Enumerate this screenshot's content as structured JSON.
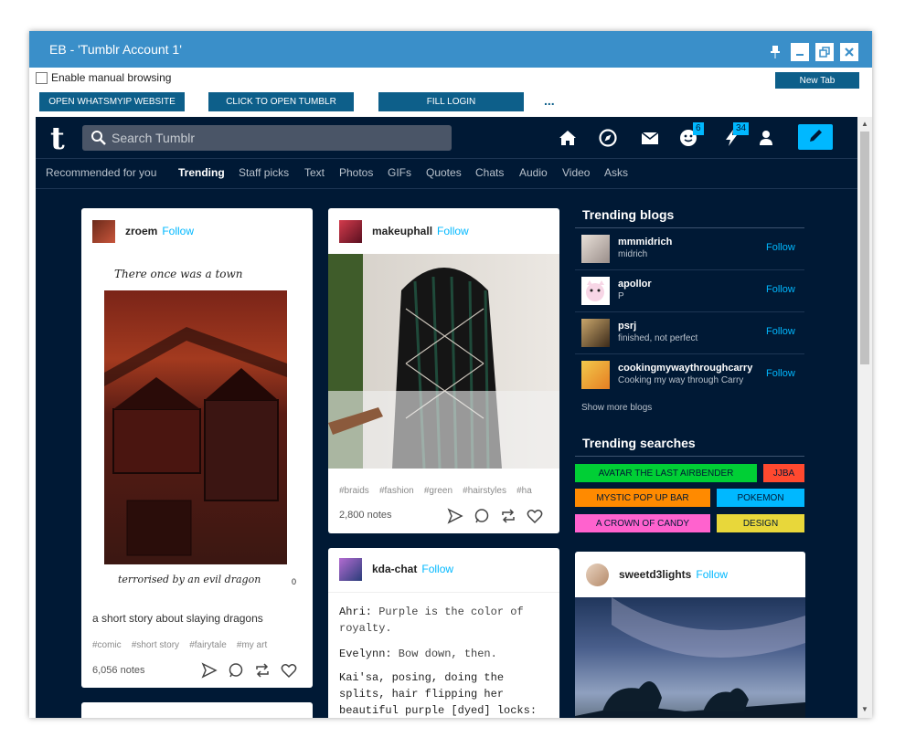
{
  "window": {
    "title": "EB - 'Tumblr Account 1'"
  },
  "toolbar": {
    "manual_browsing_label": "Enable manual browsing",
    "new_tab": "New Tab",
    "buttons": [
      "OPEN WHATSMYIP WEBSITE",
      "CLICK TO OPEN TUMBLR",
      "FILL LOGIN"
    ],
    "more": "..."
  },
  "tumblr": {
    "search_placeholder": "Search Tumblr",
    "badges": {
      "activity": "6",
      "notifications": "34"
    },
    "tabs": [
      "Recommended for you",
      "Trending",
      "Staff picks",
      "Text",
      "Photos",
      "GIFs",
      "Quotes",
      "Chats",
      "Audio",
      "Video",
      "Asks"
    ],
    "active_tab": "Trending",
    "posts": {
      "zroem": {
        "user": "zroem",
        "follow": "Follow",
        "art_caption_top": "There once was a town",
        "art_caption_bottom": "terrorised by an evil dragon",
        "page_num": "0",
        "caption": "a short story about slaying dragons",
        "tags": [
          "#comic",
          "#short story",
          "#fairytale",
          "#my art"
        ],
        "notes": "6,056 notes"
      },
      "makeuphall": {
        "user": "makeuphall",
        "follow": "Follow",
        "tags": [
          "#braids",
          "#fashion",
          "#green",
          "#hairstyles",
          "#ha"
        ],
        "notes": "2,800 notes"
      },
      "kda": {
        "user": "kda-chat",
        "follow": "Follow",
        "lines": [
          {
            "speaker": "Ahri:",
            "text": " Purple is the color of royalty."
          },
          {
            "speaker": "Evelynn:",
            "text": " Bow down, then."
          },
          {
            "speaker": "",
            "text": "Kai'sa, posing, doing the splits, hair flipping her beautiful purple [dyed] locks:"
          }
        ]
      },
      "sweet": {
        "user": "sweetd3lights",
        "follow": "Follow"
      }
    },
    "sidebar": {
      "trending_blogs_title": "Trending blogs",
      "blogs": [
        {
          "name": "mmmidrich",
          "sub": "midrich",
          "follow": "Follow"
        },
        {
          "name": "apollor",
          "sub": "P",
          "follow": "Follow"
        },
        {
          "name": "psrj",
          "sub": "finished, not perfect",
          "follow": "Follow"
        },
        {
          "name": "cookingmywaythroughcarry",
          "sub": "Cooking my way through Carry",
          "follow": "Follow"
        }
      ],
      "show_more": "Show more blogs",
      "trending_searches_title": "Trending searches",
      "searches": [
        {
          "label": "AVATAR THE LAST AIRBENDER",
          "color": "#00cf35"
        },
        {
          "label": "JJBA",
          "color": "#ff492f"
        },
        {
          "label": "MYSTIC POP UP BAR",
          "color": "#ff8a00"
        },
        {
          "label": "POKEMON",
          "color": "#00b8ff"
        },
        {
          "label": "A CROWN OF CANDY",
          "color": "#ff62ce"
        },
        {
          "label": "DESIGN",
          "color": "#e8d73a"
        }
      ]
    }
  }
}
